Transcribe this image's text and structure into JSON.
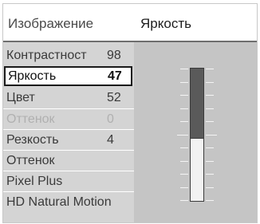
{
  "menu": {
    "title": "Изображение",
    "items": [
      {
        "label": "Контрастност",
        "value": "98",
        "state": "normal"
      },
      {
        "label": "Яркость",
        "value": "47",
        "state": "selected"
      },
      {
        "label": "Цвет",
        "value": "52",
        "state": "normal"
      },
      {
        "label": "Оттенок",
        "value": "0",
        "state": "disabled"
      },
      {
        "label": "Резкость",
        "value": "4",
        "state": "normal"
      },
      {
        "label": "Оттенок",
        "value": "",
        "state": "normal"
      },
      {
        "label": "Pixel Plus",
        "value": "",
        "state": "normal"
      },
      {
        "label": "HD Natural Motion",
        "value": "",
        "state": "normal"
      }
    ]
  },
  "detail": {
    "title": "Яркость",
    "slider_level": 47
  }
}
